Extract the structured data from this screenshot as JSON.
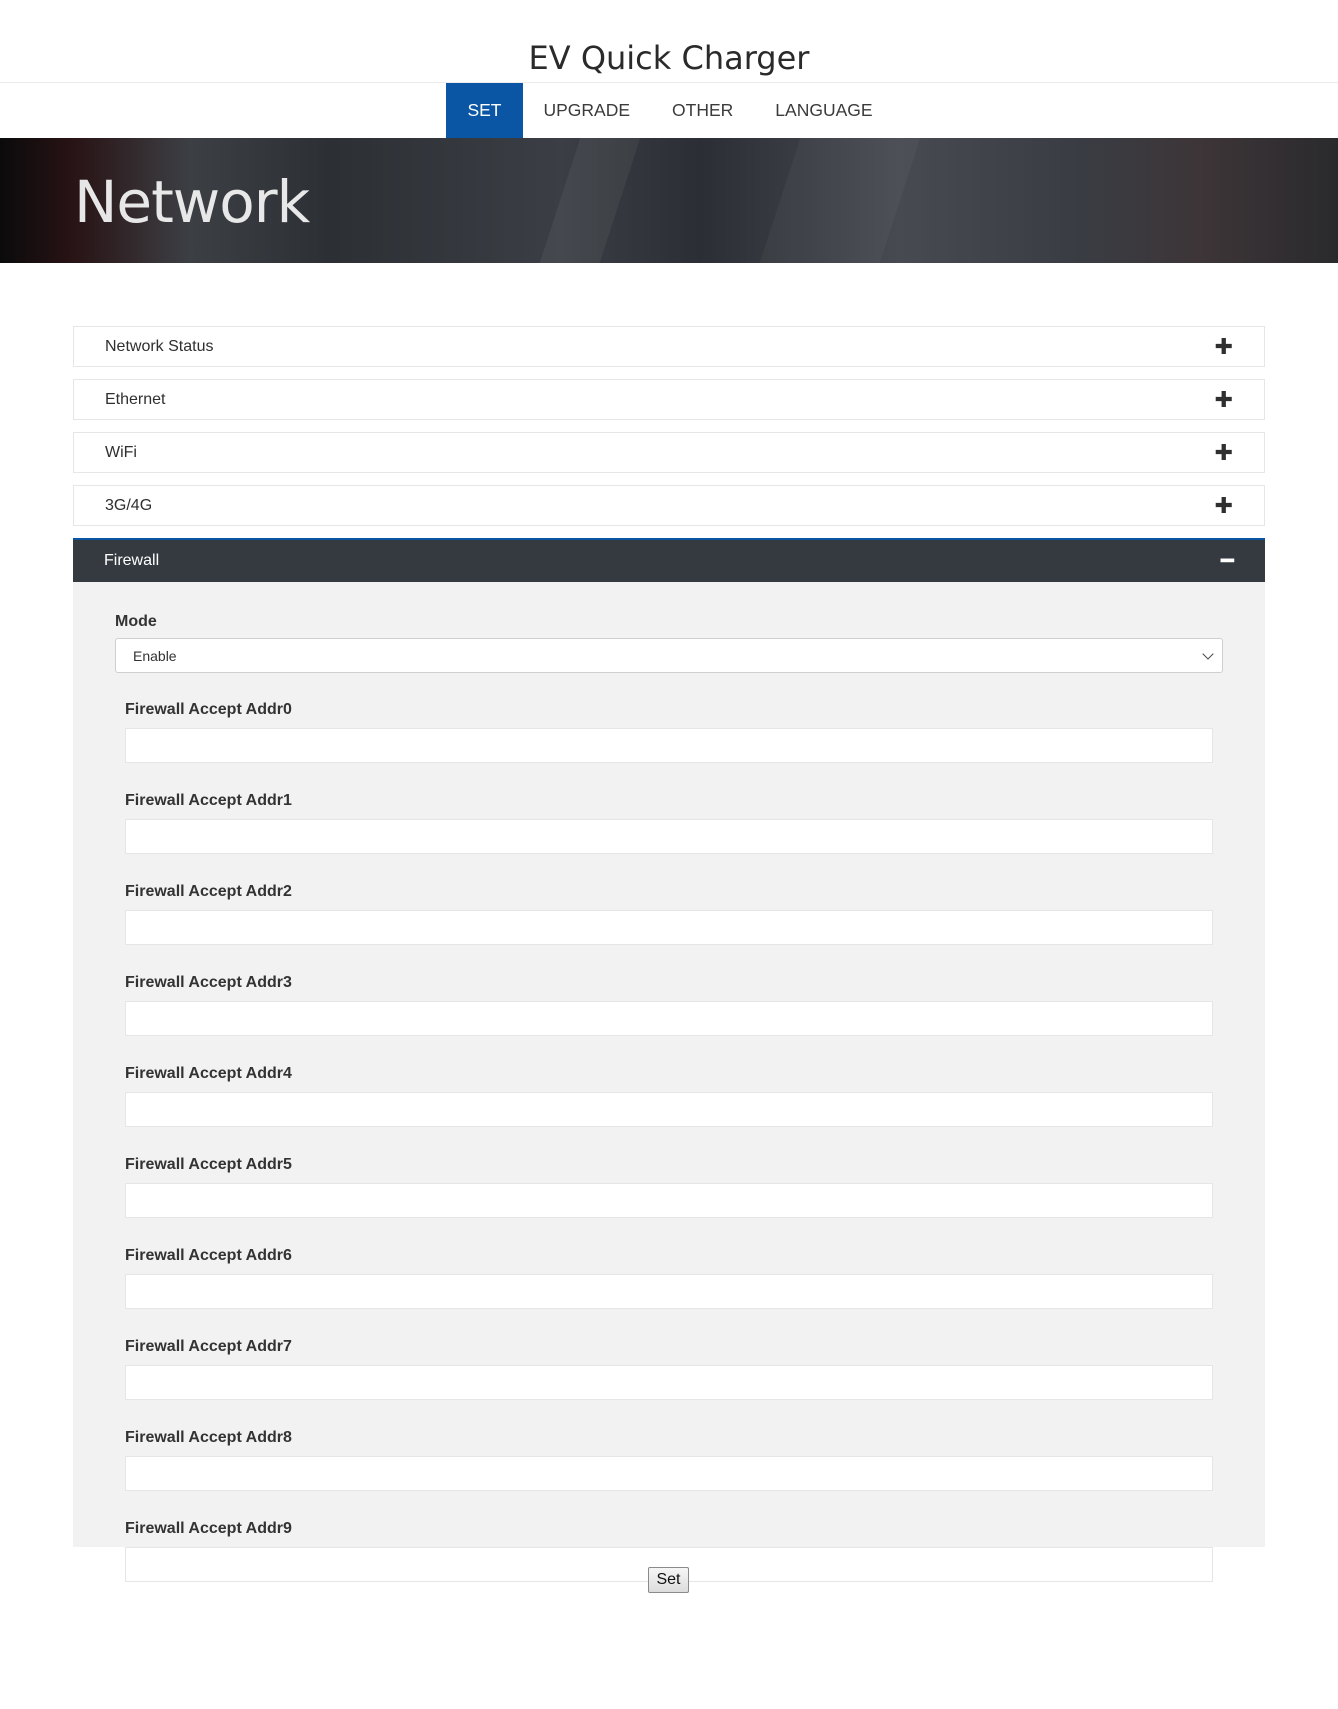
{
  "header": {
    "title": "EV Quick Charger"
  },
  "nav": {
    "items": [
      {
        "label": "SET",
        "active": true
      },
      {
        "label": "UPGRADE",
        "active": false
      },
      {
        "label": "OTHER",
        "active": false
      },
      {
        "label": "LANGUAGE",
        "active": false
      }
    ]
  },
  "hero": {
    "title": "Network"
  },
  "panels": [
    {
      "label": "Network Status",
      "icon": "plus-icon",
      "symbol": "✚",
      "open": false
    },
    {
      "label": "Ethernet",
      "icon": "plus-icon",
      "symbol": "✚",
      "open": false
    },
    {
      "label": "WiFi",
      "icon": "plus-icon",
      "symbol": "✚",
      "open": false
    },
    {
      "label": "3G/4G",
      "icon": "plus-icon",
      "symbol": "✚",
      "open": false
    },
    {
      "label": "Firewall",
      "icon": "minus-icon",
      "symbol": "━",
      "open": true
    }
  ],
  "firewall": {
    "mode_label": "Mode",
    "mode_value": "Enable",
    "fields": [
      {
        "label": "Firewall Accept Addr0",
        "value": ""
      },
      {
        "label": "Firewall Accept Addr1",
        "value": ""
      },
      {
        "label": "Firewall Accept Addr2",
        "value": ""
      },
      {
        "label": "Firewall Accept Addr3",
        "value": ""
      },
      {
        "label": "Firewall Accept Addr4",
        "value": ""
      },
      {
        "label": "Firewall Accept Addr5",
        "value": ""
      },
      {
        "label": "Firewall Accept Addr6",
        "value": ""
      },
      {
        "label": "Firewall Accept Addr7",
        "value": ""
      },
      {
        "label": "Firewall Accept Addr8",
        "value": ""
      },
      {
        "label": "Firewall Accept Addr9",
        "value": ""
      }
    ]
  },
  "actions": {
    "set_label": "Set"
  },
  "colors": {
    "accent": "#0a56a4",
    "open_panel": "#353a40",
    "panel_body": "#f2f2f2"
  }
}
